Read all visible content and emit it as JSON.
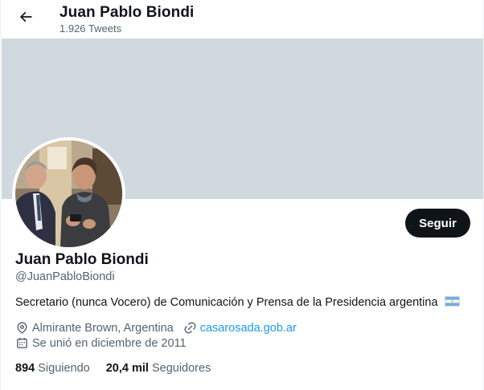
{
  "header": {
    "name": "Juan Pablo Biondi",
    "tweet_count": "1.926 Tweets"
  },
  "profile": {
    "display_name": "Juan Pablo Biondi",
    "handle": "@JuanPabloBiondi",
    "bio": "Secretario (nunca Vocero) de Comunicación y Prensa de la Presidencia argentina",
    "location": "Almirante Brown, Argentina",
    "website": "casarosada.gob.ar",
    "joined": "Se unió en diciembre de 2011",
    "following_count": "894",
    "following_label": "Siguiendo",
    "followers_count": "20,4 mil",
    "followers_label": "Seguidores"
  },
  "actions": {
    "follow_label": "Seguir"
  },
  "icons": {
    "back": "back-arrow-icon",
    "location": "location-pin-icon",
    "website": "link-icon",
    "joined": "calendar-icon",
    "bio_emoji": "argentina-flag-icon"
  },
  "colors": {
    "banner": "#cfd9de",
    "link": "#1d9bf0",
    "button_bg": "#0f1419",
    "secondary_text": "#536471"
  }
}
